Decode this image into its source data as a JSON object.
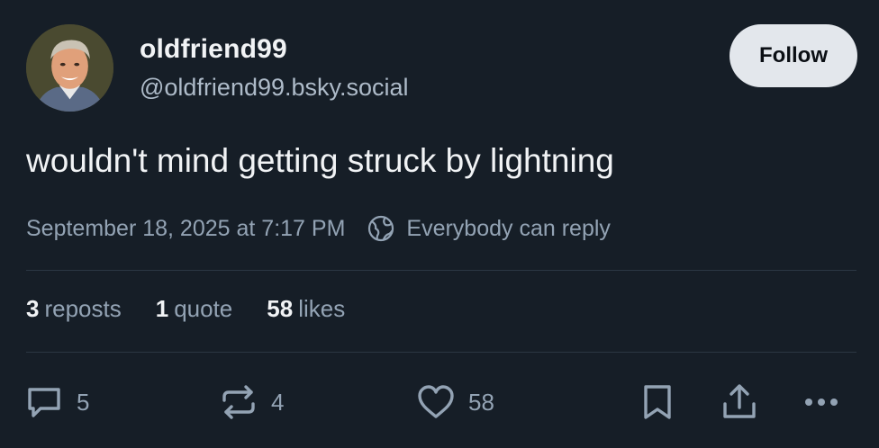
{
  "author": {
    "display_name": "oldfriend99",
    "handle": "@oldfriend99.bsky.social"
  },
  "follow_label": "Follow",
  "post": {
    "text": "wouldn't mind getting struck by lightning",
    "timestamp": "September 18, 2025 at 7:17 PM",
    "reply_setting": "Everybody can reply"
  },
  "stats": {
    "reposts_count": "3",
    "reposts_label": "reposts",
    "quotes_count": "1",
    "quotes_label": "quote",
    "likes_count": "58",
    "likes_label": "likes"
  },
  "actions": {
    "reply_count": "5",
    "repost_count": "4",
    "like_count": "58"
  },
  "icons": {
    "reply": "chat-bubble-icon",
    "repost": "repost-arrows-icon",
    "like": "heart-icon",
    "bookmark": "bookmark-icon",
    "share": "share-icon",
    "more": "ellipsis-icon",
    "reply_setting": "globe-icon"
  },
  "colors": {
    "background": "#161e27",
    "text": "#f1f3f5",
    "muted": "#93a3b4",
    "follow_button": "#e3e7ec"
  }
}
